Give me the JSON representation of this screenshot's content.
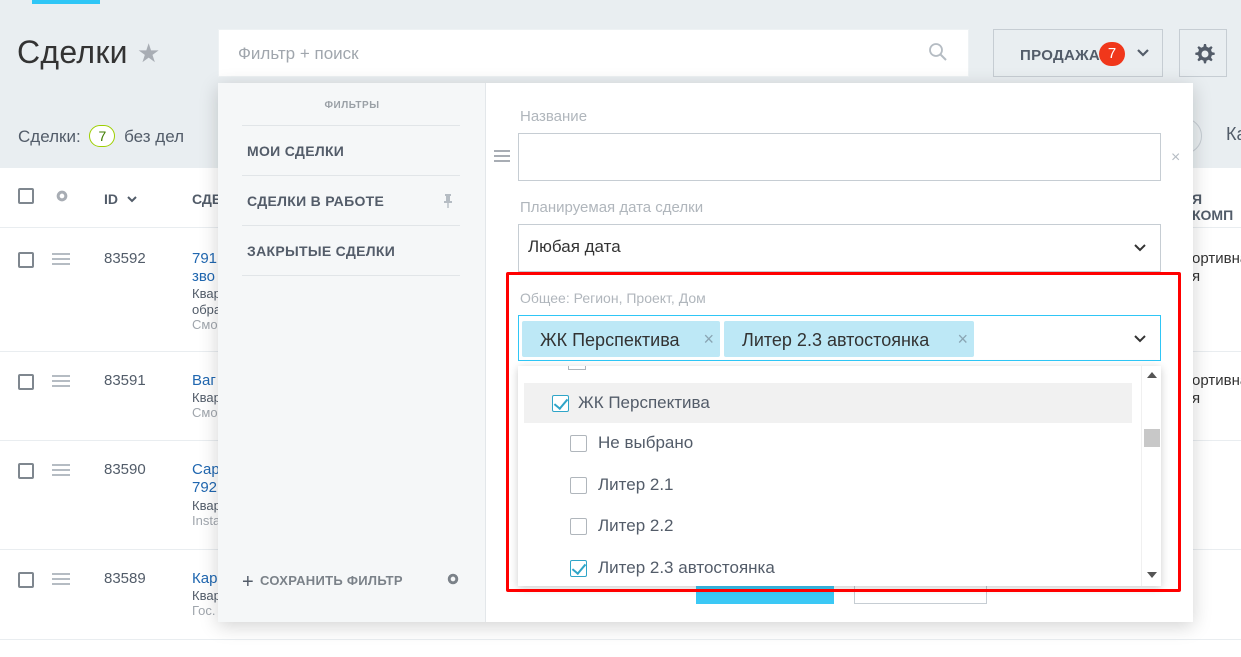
{
  "header": {
    "title": "Сделки",
    "search_placeholder": "Фильтр + поиск",
    "category_button": "ПРОДАЖА",
    "category_badge": "7",
    "counter_label": "Сделки:",
    "counter_value": "7",
    "counter_suffix": "без дел",
    "right_fragment": "Ка"
  },
  "table": {
    "header": {
      "id": "ID",
      "deal": "СДЕ",
      "company": "Я КОМП"
    },
    "rows": [
      {
        "id": "83592",
        "title": "791",
        "line2": "зво",
        "line3": "Квар",
        "line4": "обра",
        "line5": "Смо",
        "right": "ортивна\nя"
      },
      {
        "id": "83591",
        "title": "Ваг",
        "line2": "Квар",
        "line3": "Смо",
        "right": "ортивна\nя"
      },
      {
        "id": "83590",
        "title": "Сар",
        "line2": "792",
        "line3": "Квар",
        "line4": "Insta"
      },
      {
        "id": "83589",
        "title": "Кар",
        "line2": "Квар",
        "line3": "Гос."
      }
    ]
  },
  "filter_popup": {
    "left": {
      "title": "ФИЛЬТРЫ",
      "presets": [
        "МОИ СДЕЛКИ",
        "СДЕЛКИ В РАБОТЕ",
        "ЗАКРЫТЫЕ СДЕЛКИ"
      ],
      "save_label": "СОХРАНИТЬ ФИЛЬТР"
    },
    "fields": {
      "name_label": "Название",
      "name_value": "",
      "date_label": "Планируемая дата сделки",
      "date_value": "Любая дата",
      "general_label": "Общее: Регион, Проект, Дом",
      "tags": [
        "ЖК Перспектива",
        "Литер 2.3 автостоянка"
      ]
    },
    "dropdown_items": [
      {
        "label": "ЖК Перспектива",
        "checked": true,
        "level": 0
      },
      {
        "label": "Не выбрано",
        "checked": false,
        "level": 1
      },
      {
        "label": "Литер 2.1",
        "checked": false,
        "level": 1
      },
      {
        "label": "Литер 2.2",
        "checked": false,
        "level": 1
      },
      {
        "label": "Литер 2.3 автостоянка",
        "checked": true,
        "level": 1
      }
    ],
    "highlight_color": "#ff0000"
  }
}
